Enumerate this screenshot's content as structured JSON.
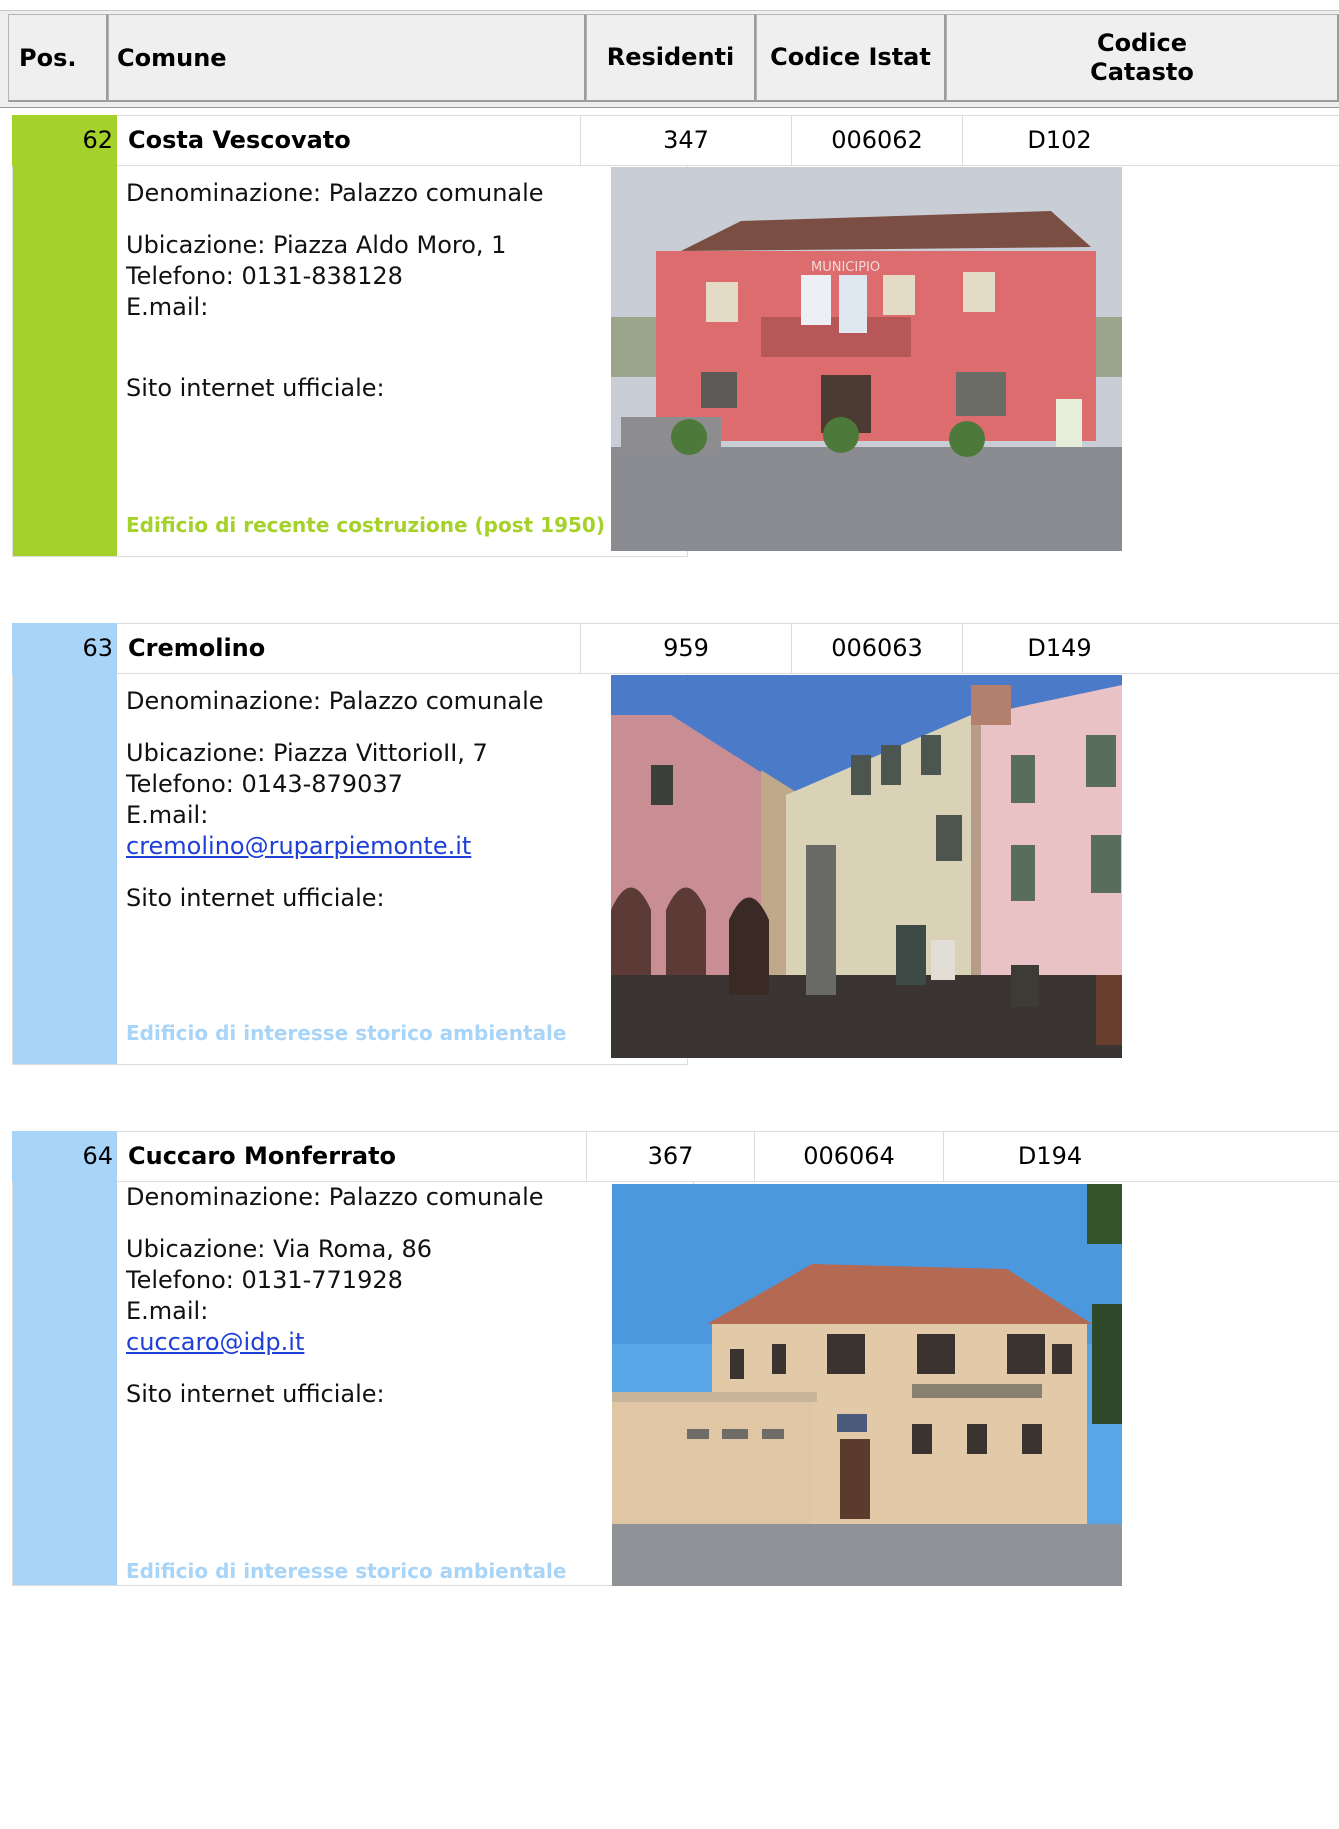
{
  "header": {
    "pos": "Pos.",
    "comune": "Comune",
    "residenti": "Residenti",
    "istat": "Codice Istat",
    "catasto_line1": "Codice",
    "catasto_line2": "Catasto"
  },
  "records": [
    {
      "pos": "62",
      "name": "Costa Vescovato",
      "residents": "347",
      "istat": "006062",
      "catasto": "D102",
      "denominazione": "Denominazione: Palazzo comunale",
      "ubicazione": "Ubicazione: Piazza Aldo Moro, 1",
      "telefono": "Telefono: 0131-838128",
      "email_label": "E.mail:",
      "email": "",
      "sito_label": "Sito internet ufficiale:",
      "note": "Edificio di recente costruzione (post 1950)",
      "accent": "#a5d22a",
      "photo_sign": "MUNICIPIO"
    },
    {
      "pos": "63",
      "name": "Cremolino",
      "residents": "959",
      "istat": "006063",
      "catasto": "D149",
      "denominazione": "Denominazione: Palazzo comunale",
      "ubicazione": "Ubicazione: Piazza VittorioII, 7",
      "telefono": "Telefono: 0143-879037",
      "email_label": "E.mail:",
      "email": "cremolino@ruparpiemonte.it",
      "sito_label": "Sito internet ufficiale:",
      "note": "Edificio di interesse storico ambientale",
      "accent": "#a8d4f8"
    },
    {
      "pos": "64",
      "name": "Cuccaro Monferrato",
      "residents": "367",
      "istat": "006064",
      "catasto": "D194",
      "denominazione": "Denominazione: Palazzo comunale",
      "ubicazione": "Ubicazione: Via Roma, 86",
      "telefono": "Telefono: 0131-771928",
      "email_label": "E.mail:",
      "email": "cuccaro@idp.it",
      "sito_label": "Sito internet ufficiale:",
      "note": "Edificio di interesse storico ambientale",
      "accent": "#a8d4f8"
    }
  ]
}
